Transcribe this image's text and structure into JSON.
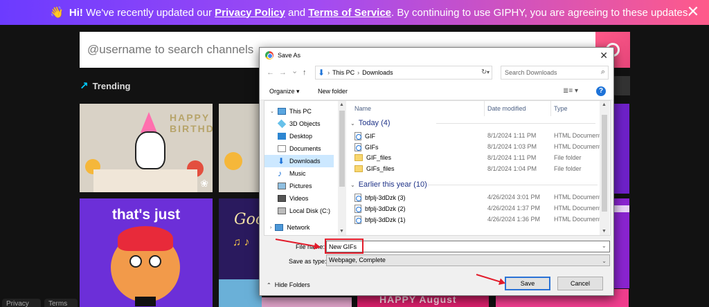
{
  "banner": {
    "wave": "👋",
    "hi": "Hi!",
    "text1": " We've recently updated our ",
    "privacy": "Privacy Policy",
    "and": " and ",
    "terms": "Terms of Service",
    "text2": ". By continuing to use GIPHY, you are agreeing to these updates.",
    "close": "✕"
  },
  "giphy": {
    "search_placeholder": "@username to search channels",
    "trending": "Trending",
    "trending_icon": "↗",
    "tile_birthday": "HAPPY BIRTHDAY",
    "tile_thats_just": "that's just",
    "tile_good": "Goo",
    "tile_notes": "♫ ♪",
    "tile_happy_august": "HAPPY August",
    "footer_privacy": "Privacy",
    "footer_terms": "Terms"
  },
  "dialog": {
    "title": "Save As",
    "close": "✕",
    "nav": {
      "back": "←",
      "forward": "→",
      "dropdown": "⌄",
      "up": "↑"
    },
    "address": {
      "seg1": "This PC",
      "sep": "›",
      "seg2": "Downloads",
      "sep0": "›"
    },
    "refresh": "↻",
    "search_placeholder": "Search Downloads",
    "toolbar": {
      "organize": "Organize ▾",
      "new_folder": "New folder",
      "view": "≣≡ ▾",
      "help": "?"
    },
    "nav_items": [
      {
        "label": "This PC"
      },
      {
        "label": "3D Objects"
      },
      {
        "label": "Desktop"
      },
      {
        "label": "Documents"
      },
      {
        "label": "Downloads"
      },
      {
        "label": "Music"
      },
      {
        "label": "Pictures"
      },
      {
        "label": "Videos"
      },
      {
        "label": "Local Disk (C:)"
      },
      {
        "label": "Network"
      }
    ],
    "columns": {
      "name": "Name",
      "date": "Date modified",
      "type": "Type"
    },
    "groups": [
      {
        "label": "Today (4)"
      },
      {
        "label": "Earlier this year (10)"
      }
    ],
    "files_today": [
      {
        "name": "GIF",
        "date": "8/1/2024 1:11 PM",
        "type": "HTML Document"
      },
      {
        "name": "GIFs",
        "date": "8/1/2024 1:03 PM",
        "type": "HTML Document"
      },
      {
        "name": "GIF_files",
        "date": "8/1/2024 1:11 PM",
        "type": "File folder"
      },
      {
        "name": "GIFs_files",
        "date": "8/1/2024 1:04 PM",
        "type": "File folder"
      }
    ],
    "files_earlier": [
      {
        "name": "bfplj-3dDzk (3)",
        "date": "4/26/2024 3:01 PM",
        "type": "HTML Document"
      },
      {
        "name": "bfplj-3dDzk (2)",
        "date": "4/26/2024 1:37 PM",
        "type": "HTML Document"
      },
      {
        "name": "bfplj-3dDzk (1)",
        "date": "4/26/2024 1:36 PM",
        "type": "HTML Document"
      }
    ],
    "file_name_label": "File name:",
    "file_name_value": "New GIFs",
    "save_type_label": "Save as type:",
    "save_type_value": "Webpage, Complete",
    "hide_folders": "Hide Folders",
    "save": "Save",
    "cancel": "Cancel"
  }
}
